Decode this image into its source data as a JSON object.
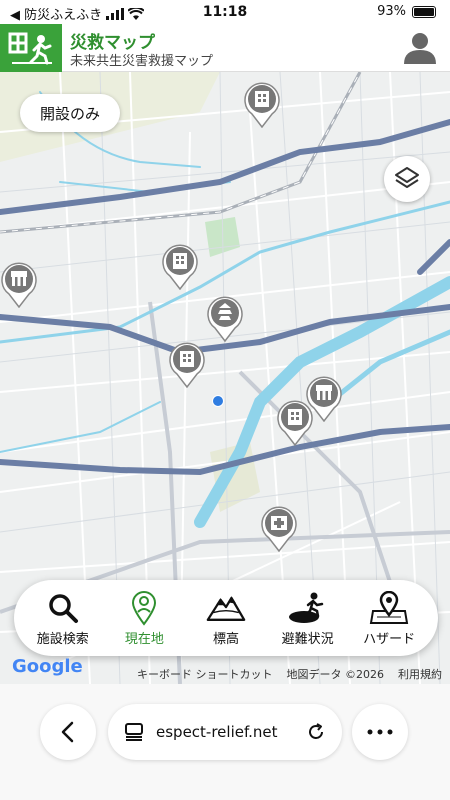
{
  "status_bar": {
    "carrier": "◀ 防災ふえふき",
    "time": "11:18",
    "battery": "93%"
  },
  "header": {
    "title": "災救マップ",
    "subtitle": "未来共生災害救援マップ"
  },
  "map": {
    "filter_label": "開設のみ",
    "layers_icon": "layers-icon",
    "user_icon": "user-icon"
  },
  "toolbar": {
    "items": [
      {
        "label": "施設検索",
        "icon": "search-icon"
      },
      {
        "label": "現在地",
        "icon": "location-pin-icon"
      },
      {
        "label": "標高",
        "icon": "mountain-icon"
      },
      {
        "label": "避難状況",
        "icon": "evacuee-icon"
      },
      {
        "label": "ハザード",
        "icon": "hazard-map-icon"
      }
    ]
  },
  "attribution": {
    "google": "Google",
    "shortcuts": "キーボード ショートカット",
    "map_data": "地図データ ©2026",
    "terms": "利用規約"
  },
  "browser": {
    "url": "espect-relief.net"
  },
  "colors": {
    "brand_green": "#3aa23a",
    "river": "#8fd3ea",
    "major_road": "#6b7ea5",
    "location_dot": "#2f7de1"
  }
}
